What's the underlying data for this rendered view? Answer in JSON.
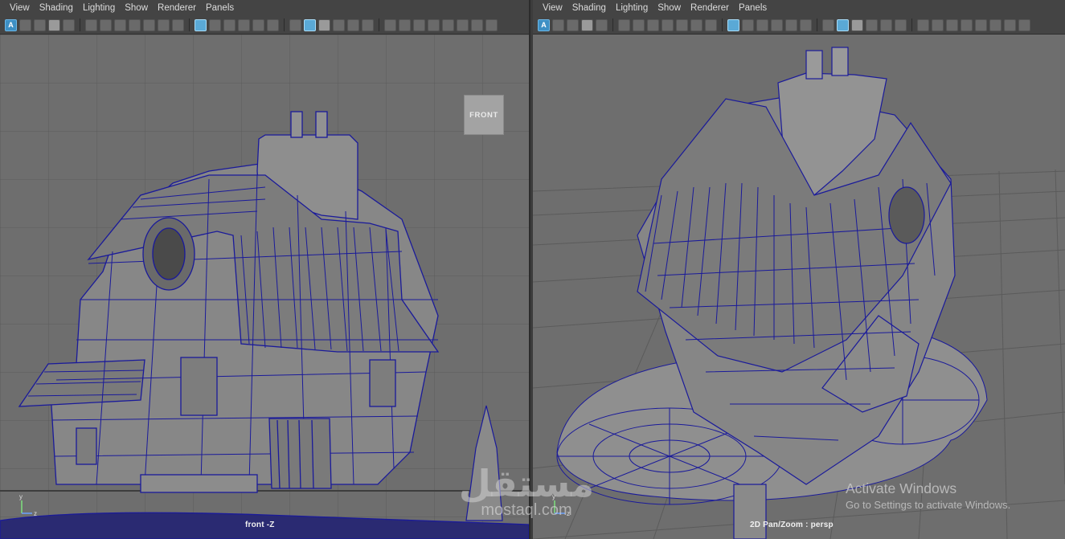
{
  "menus": [
    "View",
    "Shading",
    "Lighting",
    "Show",
    "Renderer",
    "Panels"
  ],
  "left_panel": {
    "toolbar_first_icon": "A",
    "view_cube": "FRONT",
    "camera_label": "front -Z",
    "axes": {
      "y": "y",
      "z": "z"
    }
  },
  "right_panel": {
    "camera_label": "2D Pan/Zoom : persp",
    "axes": {
      "y": "y",
      "z": "z"
    }
  },
  "watermark": {
    "arabic": "مستقل",
    "latin": "mostaql.com"
  },
  "activation": {
    "title": "Activate Windows",
    "subtitle": "Go to Settings to activate Windows."
  },
  "colors": {
    "viewport_bg": "#6e6e6e",
    "grid_line": "#5c5c5c",
    "wire": "#1a1a9a",
    "mesh_fill": "#8a8a8a",
    "menubar_bg": "#444444"
  },
  "icons": [
    "select-icon",
    "lasso-icon",
    "paint-icon",
    "camera-icon",
    "grid-icon",
    "wireframe-icon",
    "smooth-shade-icon",
    "textured-icon",
    "light-icon",
    "shadow-icon",
    "isolate-icon",
    "xray-icon"
  ]
}
